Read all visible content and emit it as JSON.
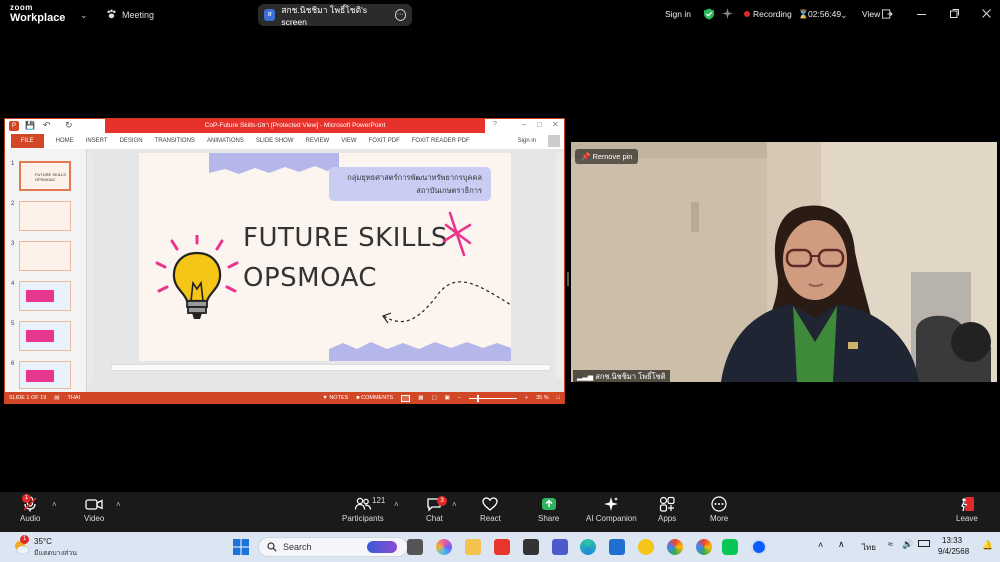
{
  "zoom": {
    "logo_top": "zoom",
    "logo_bottom": "Workplace",
    "meeting_label": "Meeting",
    "share_pill_text": "สกช.นิชชิมา  โพธิ์โชติ's screen",
    "share_icon_letter": "ส",
    "signin": "Sign in",
    "recording": "Recording",
    "timer": "02:56:49",
    "view": "View"
  },
  "ppt": {
    "title": "CoP-Future Skills-ปลา [Protected View] - Microsoft PowerPoint",
    "signin": "Sign in",
    "menu": [
      "FILE",
      "HOME",
      "INSERT",
      "DESIGN",
      "TRANSITIONS",
      "ANIMATIONS",
      "SLIDE SHOW",
      "REVIEW",
      "VIEW",
      "FOXIT PDF",
      "FOXIT READER PDF"
    ],
    "thumb_numbers": [
      "1",
      "2",
      "3",
      "4",
      "5",
      "6"
    ],
    "slide": {
      "tag_line1": "กลุ่มยุทธศาสตร์การพัฒนาทรัพยากรบุคคล",
      "tag_line2": "สถาบันเกษตราธิการ",
      "title_line1": "FUTURE SKILLS",
      "title_line2": "OPSMOAC"
    },
    "status": {
      "slide_of": "SLIDE 1 OF 19",
      "language": "THAI",
      "notes": "NOTES",
      "comments": "COMMENTS",
      "zoom": "35 %"
    }
  },
  "video": {
    "remove_pin": "Remove pin",
    "participant_name": "สกช.นิชชิมา  โพธิ์โชติ"
  },
  "controls": {
    "audio": "Audio",
    "video": "Video",
    "participants": "Participants",
    "participants_count": "121",
    "chat": "Chat",
    "chat_badge": "3",
    "react": "React",
    "share": "Share",
    "ai": "AI Companion",
    "apps": "Apps",
    "more": "More",
    "leave": "Leave",
    "audio_badge": "1"
  },
  "taskbar": {
    "weather_temp": "35°C",
    "weather_desc": "มีแดดบางส่วน",
    "search": "Search",
    "lang": "ไทย",
    "time": "13:33",
    "date": "9/4/2568"
  },
  "colors": {
    "ppt_orange": "#d24726",
    "ppt_red": "#e8312a",
    "share_green": "#2db55d",
    "record_red": "#e02828",
    "slide_pink": "#e8368f",
    "slide_purple": "#8a8fe0"
  }
}
